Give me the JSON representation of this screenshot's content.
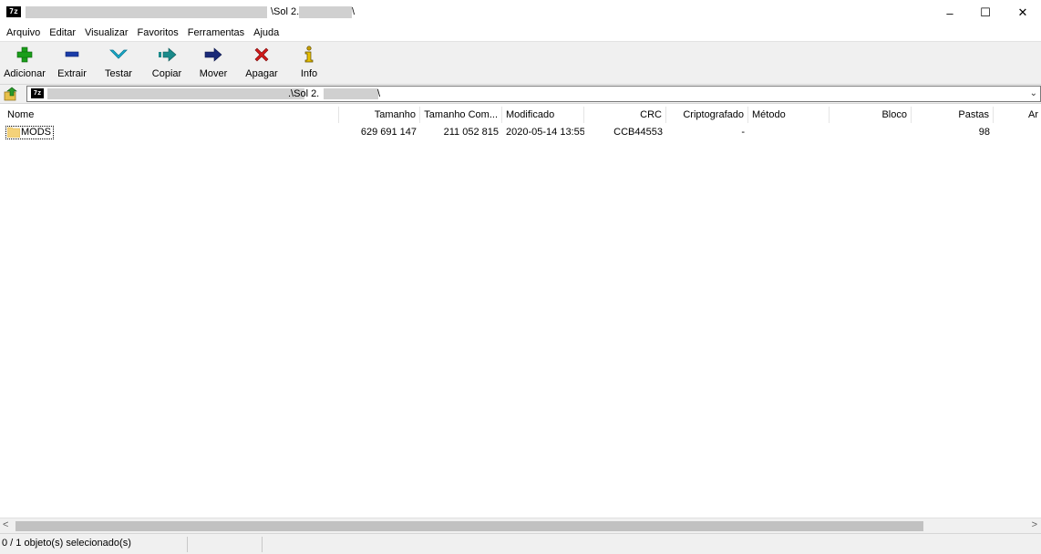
{
  "window": {
    "logo_text": "7z",
    "title_suffix": "\\Sol 2.",
    "title_end": "\\",
    "minimize": "–",
    "maximize": "☐",
    "close": "✕"
  },
  "menu": [
    "Arquivo",
    "Editar",
    "Visualizar",
    "Favoritos",
    "Ferramentas",
    "Ajuda"
  ],
  "toolbar": [
    {
      "label": "Adicionar",
      "icon": "plus-icon",
      "color": "#1a9e1a"
    },
    {
      "label": "Extrair",
      "icon": "minus-icon",
      "color": "#1a3ca8"
    },
    {
      "label": "Testar",
      "icon": "check-icon",
      "color": "#1ab0d0"
    },
    {
      "label": "Copiar",
      "icon": "copy-arrow-icon",
      "color": "#1a8a8a"
    },
    {
      "label": "Mover",
      "icon": "move-arrow-icon",
      "color": "#1a2a78"
    },
    {
      "label": "Apagar",
      "icon": "delete-x-icon",
      "color": "#d01a1a"
    },
    {
      "label": "Info",
      "icon": "info-icon",
      "color": "#c8a000"
    }
  ],
  "address": {
    "logo_text": "7z",
    "path_suffix": ".\\Sol 2.",
    "path_end": "\\",
    "dropdown": "⌄"
  },
  "columns": [
    "Nome",
    "Tamanho",
    "Tamanho Com...",
    "Modificado",
    "CRC",
    "Criptografado",
    "Método",
    "Bloco",
    "Pastas",
    "Ar"
  ],
  "rows": [
    {
      "name": "MODS",
      "size": "629 691 147",
      "packed": "211 052 815",
      "modified": "2020-05-14 13:55",
      "crc": "CCB44553",
      "encrypted": "-",
      "method": "",
      "block": "",
      "folders": "98"
    }
  ],
  "scroll": {
    "left": "<",
    "right": ">"
  },
  "status": {
    "text": "0 / 1 objeto(s) selecionado(s)"
  }
}
